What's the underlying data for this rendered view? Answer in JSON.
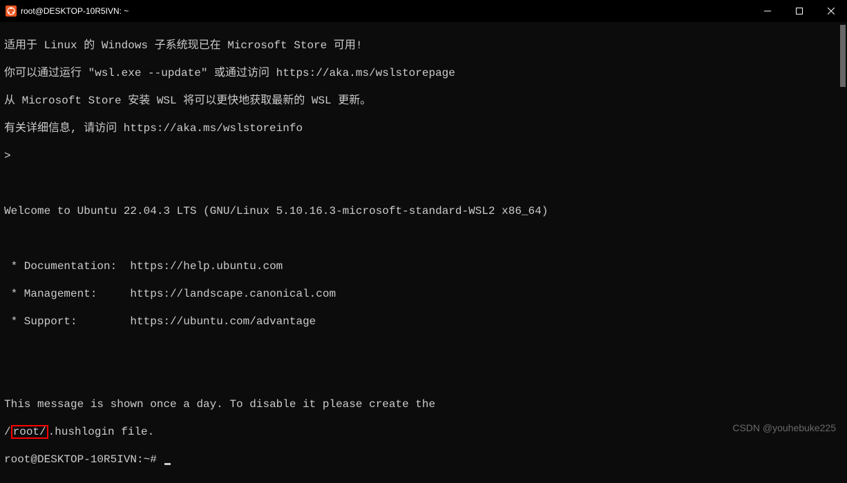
{
  "window": {
    "title": "root@DESKTOP-10R5IVN: ~"
  },
  "terminal": {
    "lines": [
      "适用于 Linux 的 Windows 子系统现已在 Microsoft Store 可用!",
      "你可以通过运行 \"wsl.exe --update\" 或通过访问 https://aka.ms/wslstorepage",
      "从 Microsoft Store 安装 WSL 将可以更快地获取最新的 WSL 更新。",
      "有关详细信息, 请访问 https://aka.ms/wslstoreinfo",
      ">",
      "",
      "Welcome to Ubuntu 22.04.3 LTS (GNU/Linux 5.10.16.3-microsoft-standard-WSL2 x86_64)",
      "",
      " * Documentation:  https://help.ubuntu.com",
      " * Management:     https://landscape.canonical.com",
      " * Support:        https://ubuntu.com/advantage",
      "",
      "",
      "This message is shown once a day. To disable it please create the"
    ],
    "hushlogin_prefix": "/",
    "hushlogin_boxed": "root/",
    "hushlogin_suffix": ".hushlogin file.",
    "prompt": "root@DESKTOP-10R5IVN:~# "
  },
  "watermark": "CSDN @youhebuke225"
}
